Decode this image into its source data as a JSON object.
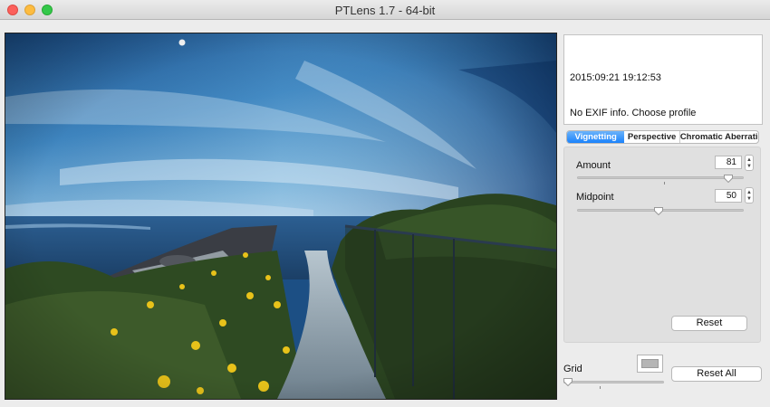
{
  "window": {
    "title": "PTLens 1.7 - 64-bit"
  },
  "photo": {
    "description_icon": "landscape-photo"
  },
  "info": {
    "datetime": "2015:09:21 19:12:53",
    "exif_message": "No EXIF info. Choose profile"
  },
  "tabs": [
    {
      "label": "Vignetting",
      "selected": true
    },
    {
      "label": "Perspective",
      "selected": false
    },
    {
      "label": "Chromatic Aberration",
      "selected": false
    }
  ],
  "vignetting": {
    "amount_label": "Amount",
    "amount_value": "81",
    "midpoint_label": "Midpoint",
    "midpoint_value": "50",
    "reset_label": "Reset"
  },
  "bottom": {
    "grid_label": "Grid",
    "reset_all_label": "Reset All"
  },
  "colors": {
    "accent": "#1a82fb",
    "close": "#fc605b",
    "minimize": "#fdbc40",
    "maximize": "#34c84a"
  }
}
